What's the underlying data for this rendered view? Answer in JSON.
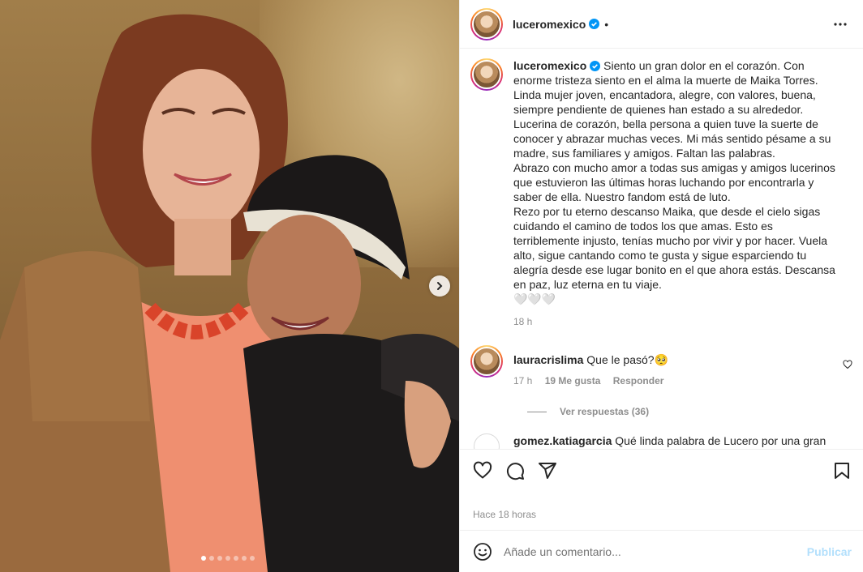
{
  "post": {
    "username": "luceromexico",
    "more_label": "•",
    "caption": "Siento un gran dolor en el corazón. Con enorme tristeza siento en el alma la muerte de Maika Torres. Linda mujer joven, encantadora, alegre, con valores, buena, siempre pendiente de quienes han estado a su alrededor.\nLucerina de corazón, bella persona a quien tuve la suerte de conocer y abrazar muchas veces. Mi más sentido pésame a su madre, sus familiares y amigos. Faltan las palabras.\nAbrazo con mucho amor a todas sus amigas y amigos lucerinos que estuvieron las últimas horas luchando por encontrarla y saber de ella. Nuestro fandom está de luto.\nRezo por tu eterno descanso Maika, que desde el cielo sigas cuidando el camino de todos los que amas. Esto es terriblemente injusto, tenías mucho por vivir y por hacer. Vuela alto, sigue cantando como te gusta y sigue esparciendo tu alegría desde ese lugar bonito en el que ahora estás. Descansa en paz, luz eterna en tu viaje.\n🤍🤍🤍",
    "caption_time": "18 h",
    "posted_ago": "Hace 18 horas",
    "carousel": {
      "slides": 7,
      "active_index": 0
    }
  },
  "comments": [
    {
      "username": "lauracrislima",
      "text": "Que le pasó?🥺",
      "time": "17 h",
      "likes": "19 Me gusta",
      "reply": "Responder",
      "view_replies": "Ver respuestas (36)"
    },
    {
      "username": "gomez.katiagarcia",
      "text": "Qué linda palabra de Lucero por una gran"
    }
  ],
  "add_comment": {
    "placeholder": "Añade un comentario...",
    "publish": "Publicar"
  },
  "colors": {
    "verified": "#0095f6",
    "publish_disabled": "#b2dffc",
    "secondary_text": "#8e8e8e"
  }
}
